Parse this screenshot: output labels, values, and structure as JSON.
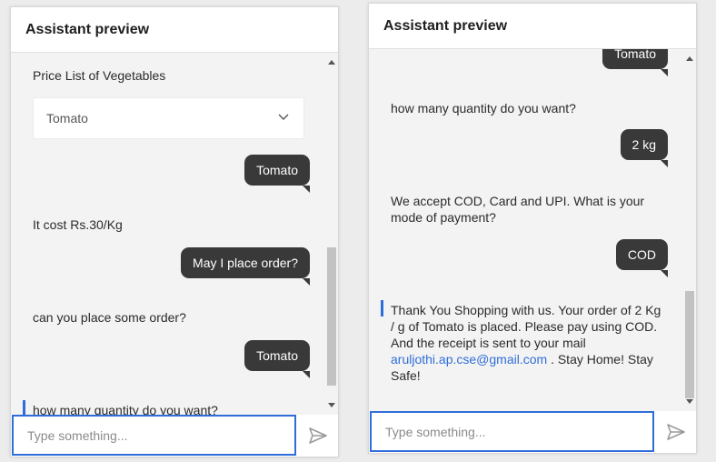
{
  "left": {
    "header_title": "Assistant preview",
    "price_list_title": "Price List of Vegetables",
    "dropdown_selected": "Tomato",
    "user_msg_1": "Tomato",
    "bot_cost": "It cost Rs.30/Kg",
    "user_msg_2": "May I place order?",
    "bot_place": "can you place some order?",
    "user_msg_3": "Tomato",
    "bot_quantity": "how many quantity do you want?",
    "input_placeholder": "Type something..."
  },
  "right": {
    "header_title": "Assistant preview",
    "user_msg_top": "Tomato",
    "bot_quantity": "how many quantity do you want?",
    "user_msg_qty": "2 kg",
    "bot_payment": "We accept COD, Card and UPI. What is your mode of payment?",
    "user_msg_payment": "COD",
    "bot_confirm_text": "Thank You Shopping with us. Your order of 2 Kg / g of Tomato is placed. Please pay using COD. And the receipt is sent to your mail",
    "bot_confirm_email": "aruljothi.ap.cse@gmail.com",
    "bot_confirm_end": ". Stay Home! Stay Safe!",
    "input_placeholder": "Type something..."
  },
  "icons": {
    "send": "send-icon",
    "chevron": "chevron-down-icon"
  },
  "colors": {
    "accent": "#2f6ed8",
    "user_bubble": "#393939",
    "panel_bg": "#f3f3f3"
  }
}
